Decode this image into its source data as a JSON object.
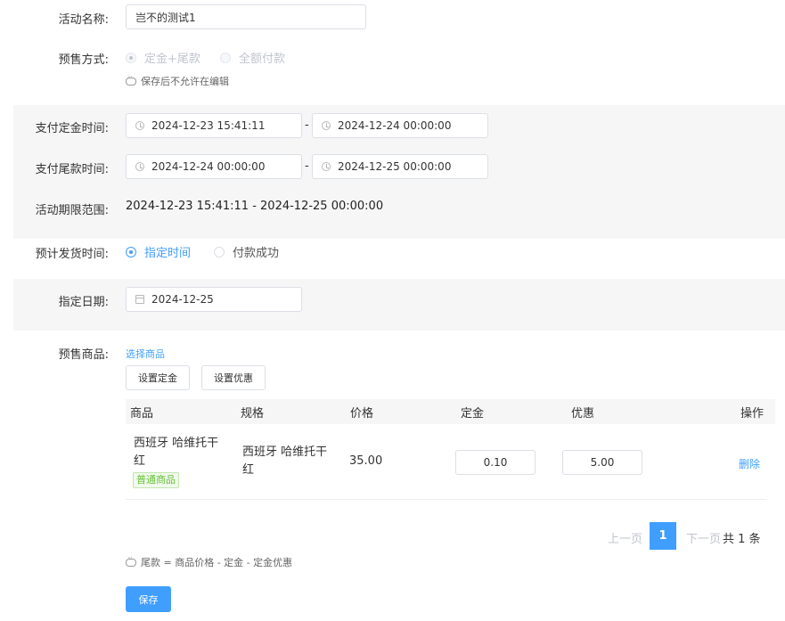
{
  "form": {
    "name_label": "活动名称:",
    "name_value": "岂不的测试1",
    "mode_label": "预售方式:",
    "mode_options": [
      "定金+尾款",
      "全额付款"
    ],
    "mode_hint": "保存后不允许在编辑",
    "deposit_time_label": "支付定金时间:",
    "deposit_start": "2024-12-23 15:41:11",
    "deposit_end": "2024-12-24 00:00:00",
    "balance_time_label": "支付尾款时间:",
    "balance_start": "2024-12-24 00:00:00",
    "balance_end": "2024-12-25 00:00:00",
    "range_label": "活动期限范围:",
    "range_value": "2024-12-23 15:41:11 - 2024-12-25 00:00:00",
    "ship_label": "预计发货时间:",
    "ship_options": [
      "指定时间",
      "付款成功"
    ],
    "date_label": "指定日期:",
    "date_value": "2024-12-25",
    "goods_label": "预售商品:",
    "select_goods": "选择商品",
    "set_deposit_btn": "设置定金",
    "set_discount_btn": "设置优惠",
    "separator": "-"
  },
  "table": {
    "headers": [
      "商品",
      "规格",
      "价格",
      "定金",
      "优惠",
      "操作"
    ],
    "rows": [
      {
        "product_line1": "西班牙 哈维托干",
        "product_line2": "红",
        "tag": "普通商品",
        "spec_line1": "西班牙 哈维托干",
        "spec_line2": "红",
        "price": "35.00",
        "deposit": "0.10",
        "discount": "5.00",
        "action": "删除"
      }
    ]
  },
  "pager": {
    "prev": "上一页",
    "current": "1",
    "next": "下一页",
    "total": "共 1 条"
  },
  "footer": {
    "formula_hint": "尾款 = 商品价格 - 定金 - 定金优惠",
    "save_label": "保存"
  },
  "colors": {
    "accent": "#409eff",
    "band": "#f6f6f6",
    "tag_green": "#67c23a"
  }
}
